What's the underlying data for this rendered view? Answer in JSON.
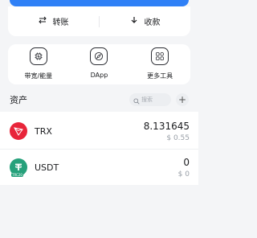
{
  "actions": {
    "transfer_label": "转账",
    "receive_label": "收款"
  },
  "tools": [
    {
      "label": "带宽/能量",
      "icon": "energy-chip-icon"
    },
    {
      "label": "DApp",
      "icon": "compass-icon"
    },
    {
      "label": "更多工具",
      "icon": "grid-apps-icon"
    }
  ],
  "assets": {
    "title": "资产",
    "search_placeholder": "搜索",
    "add_label": "+"
  },
  "tokens": [
    {
      "symbol": "TRX",
      "amount": "8.131645",
      "fiat": "$ 0.55",
      "color": "#e8253a"
    },
    {
      "symbol": "USDT",
      "amount": "0",
      "fiat": "$ 0",
      "color": "#26a17b",
      "tag": "TRC20"
    }
  ],
  "colors": {
    "accent": "#2f80f6",
    "background": "#f4f5f7",
    "muted_text": "#9aa0a8"
  }
}
